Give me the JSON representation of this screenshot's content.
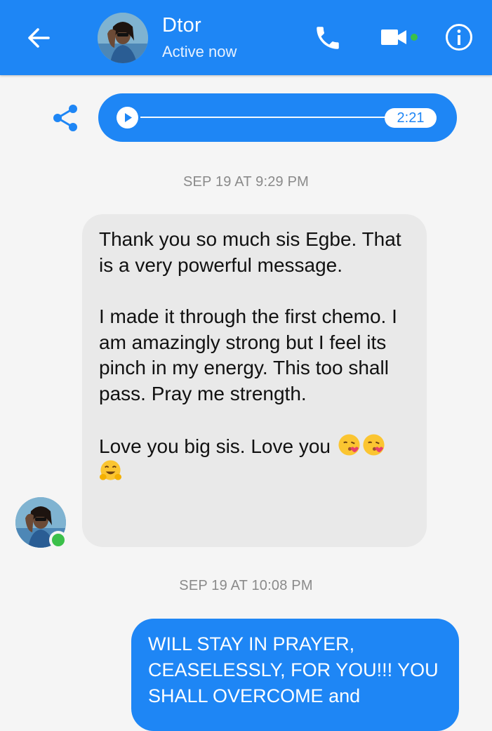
{
  "header": {
    "contact_name": "Dtor",
    "status": "Active now",
    "back_icon": "arrow-left-icon",
    "call_icon": "phone-icon",
    "video_icon": "video-camera-icon",
    "info_icon": "info-icon",
    "accent": "#1e86f5",
    "online_color": "#3bc04a"
  },
  "audio_message": {
    "duration": "2:21",
    "progress": 0,
    "share_icon": "share-icon",
    "play_icon": "play-icon"
  },
  "messages": [
    {
      "timestamp": "SEP 19 AT 9:29 PM",
      "direction": "received",
      "paragraph1": "Thank you so much sis Egbe. That is a very powerful message.",
      "paragraph2": "I made it through the first chemo. I am amazingly strong but I feel its pinch in my energy. This too shall pass. Pray me strength.",
      "paragraph3": "Love you big sis. Love you",
      "emojis": [
        "kissing-face-emoji",
        "kissing-face-emoji",
        "grinning-hug-emoji"
      ]
    },
    {
      "timestamp": "SEP 19 AT 10:08 PM",
      "direction": "sent",
      "text": "WILL STAY IN PRAYER, CEASELESSLY, FOR YOU!!! YOU SHALL OVERCOME and"
    }
  ]
}
